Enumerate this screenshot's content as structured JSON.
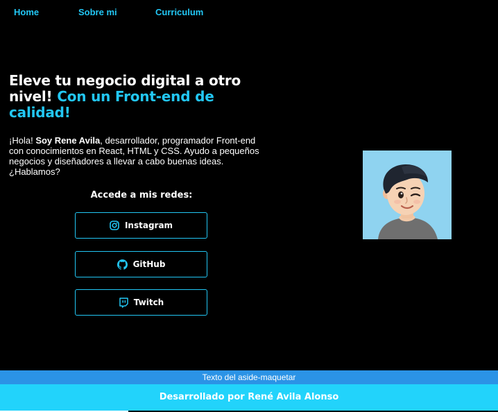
{
  "nav": {
    "items": [
      {
        "label": "Home"
      },
      {
        "label": "Sobre mi"
      },
      {
        "label": "Curriculum"
      }
    ]
  },
  "hero": {
    "title_part1": "Eleve tu negocio digital a otro nivel!",
    "title_part2": "Con un Front-end de calidad!"
  },
  "intro": {
    "greeting": "¡Hola!",
    "name": "Soy Rene Avila",
    "rest": ", desarrollador, programador Front-end con conocimientos en React, HTML y CSS. Ayudo a pequeños negocios y diseñadores a llevar a cabo buenas ideas. ¿Hablamos?"
  },
  "social": {
    "title": "Accede a mis redes:",
    "buttons": [
      {
        "label": "Instagram",
        "icon": "instagram-icon"
      },
      {
        "label": "GitHub",
        "icon": "github-icon"
      },
      {
        "label": "Twitch",
        "icon": "twitch-icon"
      }
    ]
  },
  "aside": {
    "text": "Texto del aside-maquetar"
  },
  "footer": {
    "text": "Desarrollado por René Avila Alonso"
  },
  "colors": {
    "accent": "#22c7f5",
    "background": "#000000",
    "aside_bar": "#2b93e6",
    "footer": "#22d3fb",
    "avatar_bg": "#8fd3f0"
  }
}
